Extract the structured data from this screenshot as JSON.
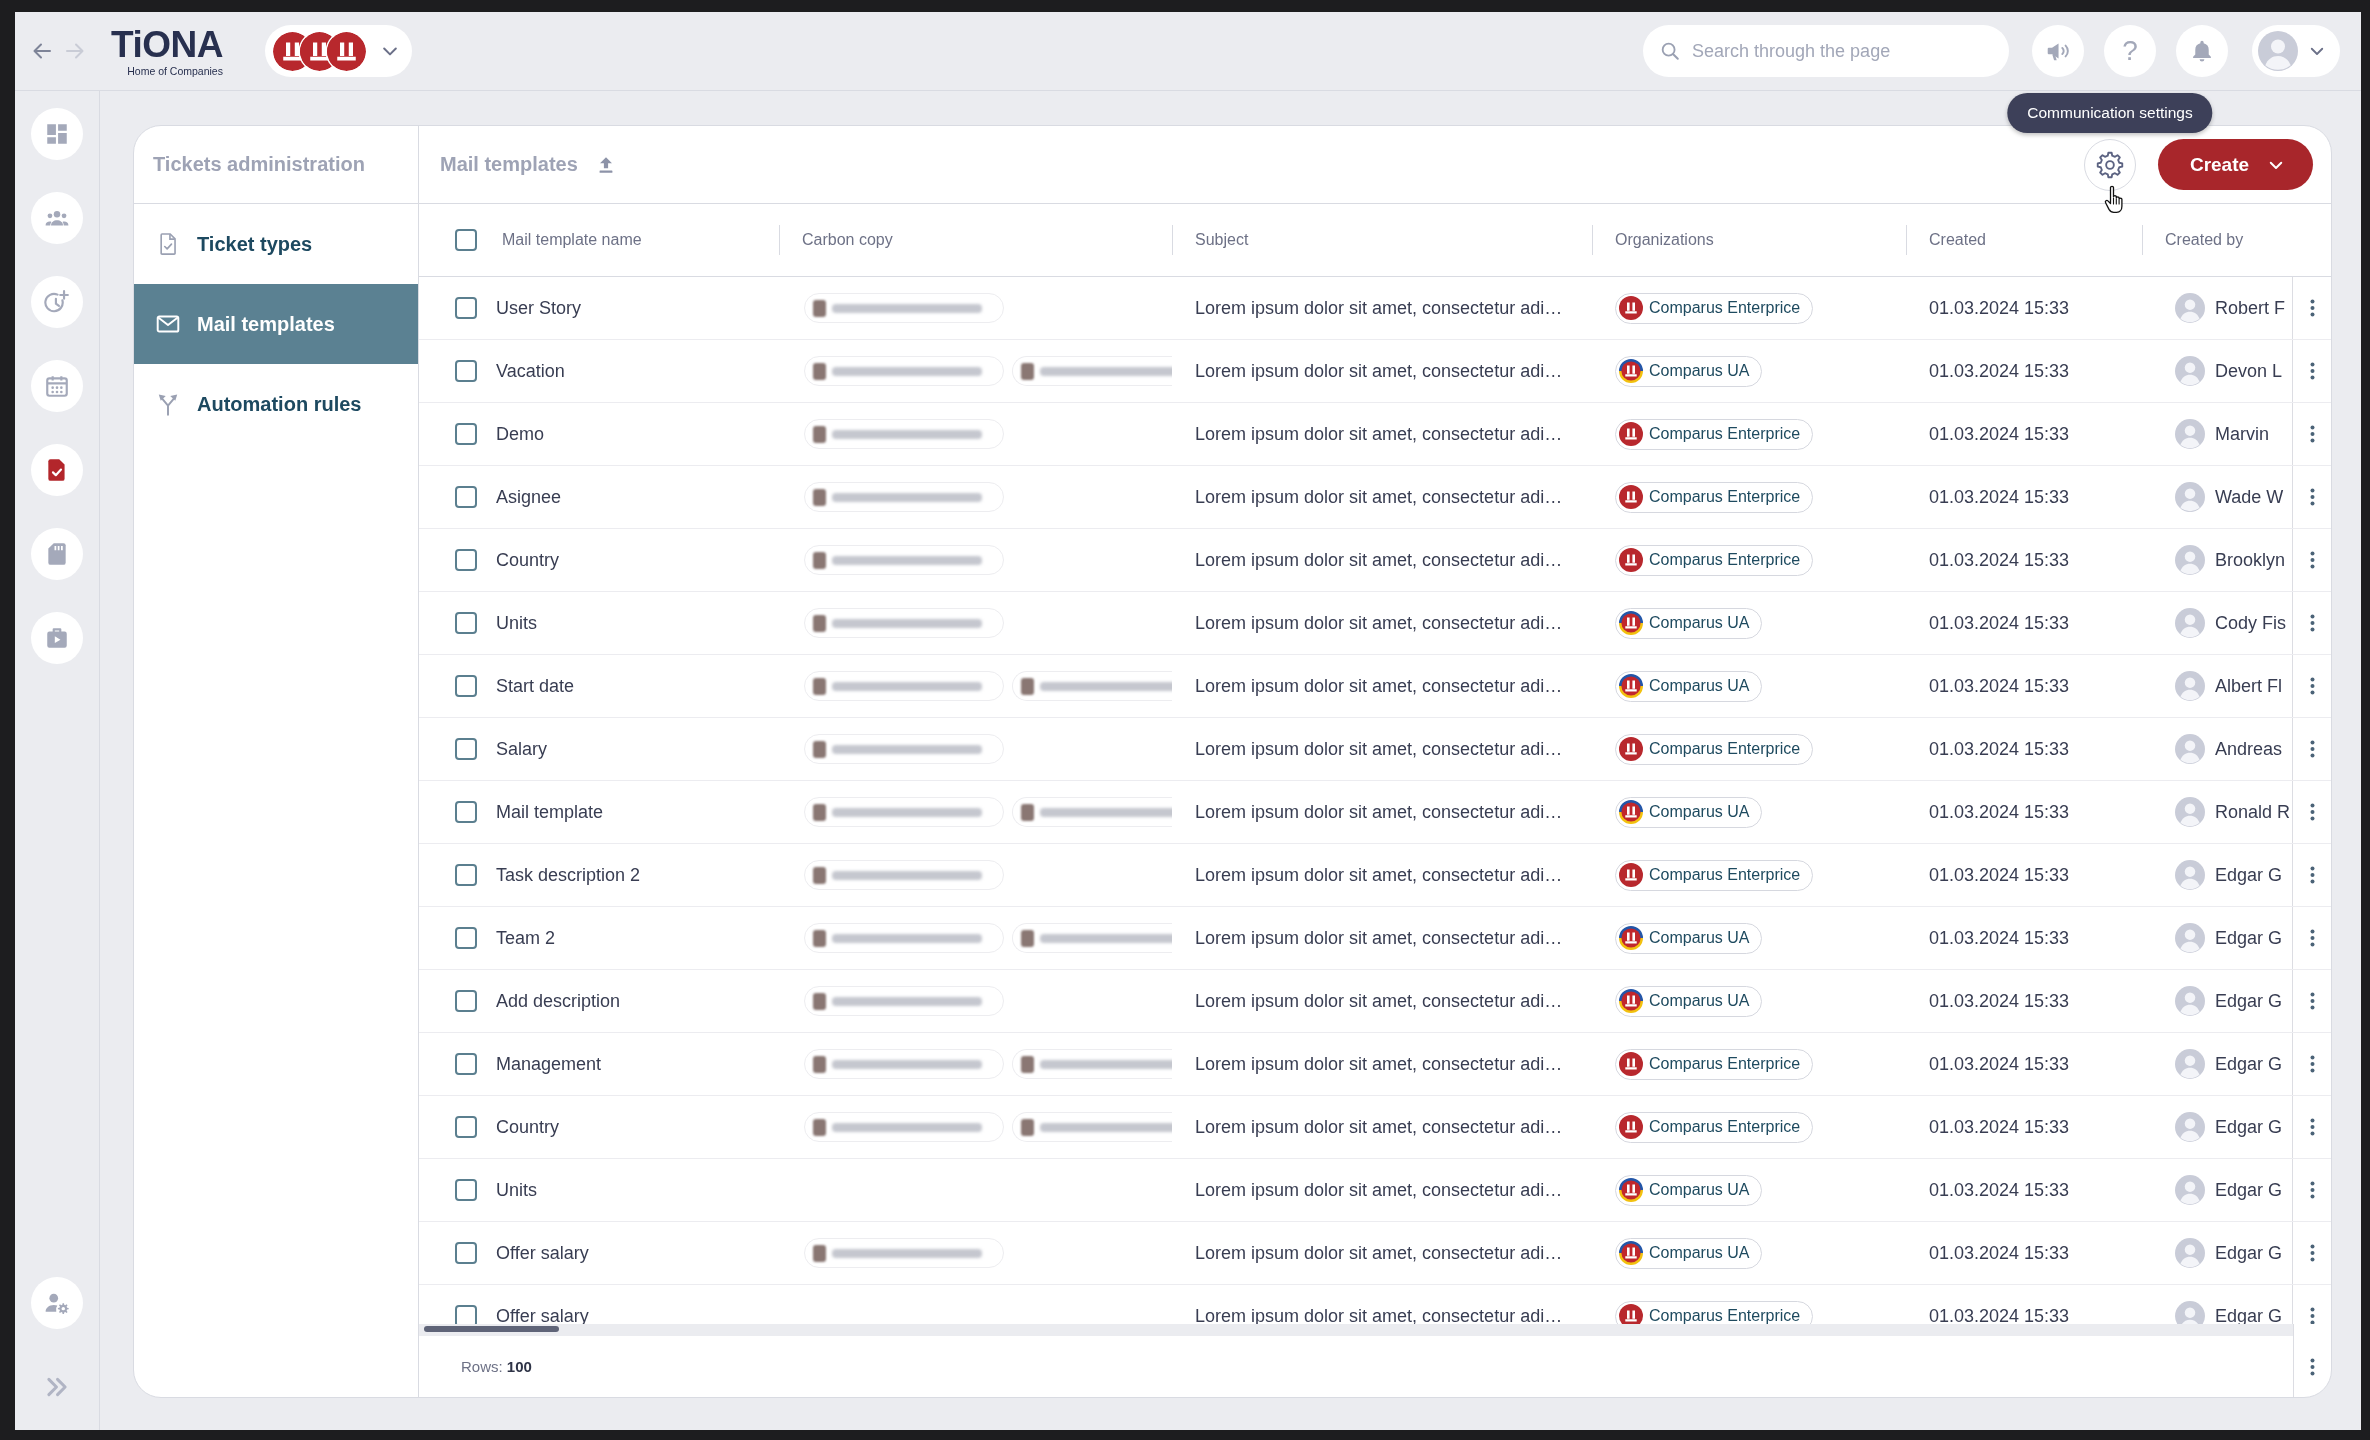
{
  "topbar": {
    "back": {
      "disabled": false
    },
    "forward": {
      "disabled": true
    },
    "logo": {
      "wordmark": "TiONA",
      "tagline": "Home of Companies"
    },
    "search": {
      "placeholder": "Search through the page"
    },
    "help": "?"
  },
  "rail": {
    "items": [
      {
        "selected": false
      },
      {
        "selected": false
      },
      {
        "selected": false
      },
      {
        "selected": false
      },
      {
        "selected": true
      },
      {
        "selected": false
      },
      {
        "selected": false
      }
    ]
  },
  "panel": {
    "title": "Tickets administration",
    "items": [
      {
        "label": "Ticket types",
        "selected": false
      },
      {
        "label": "Mail templates",
        "selected": true
      },
      {
        "label": "Automation rules",
        "selected": false
      }
    ]
  },
  "content": {
    "title": "Mail templates",
    "tooltip": "Communication settings",
    "create_button": "Create"
  },
  "table": {
    "select_all": {
      "checked": false
    },
    "columns": [
      "Mail template name",
      "Carbon copy",
      "Subject",
      "Organizations",
      "Created",
      "Created by"
    ],
    "rows": [
      {
        "name": "User Story",
        "selected": false,
        "carbon_copy": [
          {
            "kind": "blurred"
          }
        ],
        "subject": "Lorem ipsum dolor sit amet, consectetur adi…",
        "organization": {
          "name": "Comparus Enterprice",
          "kind": "plain"
        },
        "created": "01.03.2024 15:33",
        "created_by": "Robert F"
      },
      {
        "name": "Vacation",
        "selected": false,
        "carbon_copy": [
          {
            "kind": "blurred"
          },
          {
            "kind": "blurred"
          }
        ],
        "subject": "Lorem ipsum dolor sit amet, consectetur adi…",
        "organization": {
          "name": "Comparus UA",
          "kind": "ringed"
        },
        "created": "01.03.2024 15:33",
        "created_by": "Devon L"
      },
      {
        "name": "Demo",
        "selected": false,
        "carbon_copy": [
          {
            "kind": "blurred"
          }
        ],
        "subject": "Lorem ipsum dolor sit amet, consectetur adi…",
        "organization": {
          "name": "Comparus Enterprice",
          "kind": "plain"
        },
        "created": "01.03.2024 15:33",
        "created_by": "Marvin"
      },
      {
        "name": "Asignee",
        "selected": false,
        "carbon_copy": [
          {
            "kind": "blurred"
          }
        ],
        "subject": "Lorem ipsum dolor sit amet, consectetur adi…",
        "organization": {
          "name": "Comparus Enterprice",
          "kind": "plain"
        },
        "created": "01.03.2024 15:33",
        "created_by": "Wade W"
      },
      {
        "name": "Country",
        "selected": false,
        "carbon_copy": [
          {
            "kind": "blurred"
          }
        ],
        "subject": "Lorem ipsum dolor sit amet, consectetur adi…",
        "organization": {
          "name": "Comparus Enterprice",
          "kind": "plain"
        },
        "created": "01.03.2024 15:33",
        "created_by": "Brooklyn"
      },
      {
        "name": "Units",
        "selected": false,
        "carbon_copy": [
          {
            "kind": "blurred"
          }
        ],
        "subject": "Lorem ipsum dolor sit amet, consectetur adi…",
        "organization": {
          "name": "Comparus UA",
          "kind": "ringed"
        },
        "created": "01.03.2024 15:33",
        "created_by": "Cody Fis"
      },
      {
        "name": "Start date",
        "selected": false,
        "carbon_copy": [
          {
            "kind": "blurred"
          },
          {
            "kind": "blurred"
          }
        ],
        "subject": "Lorem ipsum dolor sit amet, consectetur adi…",
        "organization": {
          "name": "Comparus UA",
          "kind": "ringed"
        },
        "created": "01.03.2024 15:33",
        "created_by": "Albert Fl"
      },
      {
        "name": "Salary",
        "selected": false,
        "carbon_copy": [
          {
            "kind": "blurred"
          }
        ],
        "subject": "Lorem ipsum dolor sit amet, consectetur adi…",
        "organization": {
          "name": "Comparus Enterprice",
          "kind": "plain"
        },
        "created": "01.03.2024 15:33",
        "created_by": "Andreas"
      },
      {
        "name": "Mail template",
        "selected": false,
        "carbon_copy": [
          {
            "kind": "blurred"
          },
          {
            "kind": "blurred"
          }
        ],
        "subject": "Lorem ipsum dolor sit amet, consectetur adi…",
        "organization": {
          "name": "Comparus UA",
          "kind": "ringed"
        },
        "created": "01.03.2024 15:33",
        "created_by": "Ronald R"
      },
      {
        "name": "Task description 2",
        "selected": false,
        "carbon_copy": [
          {
            "kind": "blurred"
          }
        ],
        "subject": "Lorem ipsum dolor sit amet, consectetur adi…",
        "organization": {
          "name": "Comparus Enterprice",
          "kind": "plain"
        },
        "created": "01.03.2024 15:33",
        "created_by": "Edgar G"
      },
      {
        "name": "Team 2",
        "selected": false,
        "carbon_copy": [
          {
            "kind": "blurred"
          },
          {
            "kind": "blurred"
          }
        ],
        "subject": "Lorem ipsum dolor sit amet, consectetur adi…",
        "organization": {
          "name": "Comparus UA",
          "kind": "ringed"
        },
        "created": "01.03.2024 15:33",
        "created_by": "Edgar G"
      },
      {
        "name": "Add description",
        "selected": false,
        "carbon_copy": [
          {
            "kind": "blurred"
          }
        ],
        "subject": "Lorem ipsum dolor sit amet, consectetur adi…",
        "organization": {
          "name": "Comparus UA",
          "kind": "ringed"
        },
        "created": "01.03.2024 15:33",
        "created_by": "Edgar G"
      },
      {
        "name": "Management",
        "selected": false,
        "carbon_copy": [
          {
            "kind": "blurred"
          },
          {
            "kind": "blurred"
          }
        ],
        "subject": "Lorem ipsum dolor sit amet, consectetur adi…",
        "organization": {
          "name": "Comparus Enterprice",
          "kind": "plain"
        },
        "created": "01.03.2024 15:33",
        "created_by": "Edgar G"
      },
      {
        "name": "Country",
        "selected": false,
        "carbon_copy": [
          {
            "kind": "blurred"
          },
          {
            "kind": "blurred"
          }
        ],
        "subject": "Lorem ipsum dolor sit amet, consectetur adi…",
        "organization": {
          "name": "Comparus Enterprice",
          "kind": "plain"
        },
        "created": "01.03.2024 15:33",
        "created_by": "Edgar G"
      },
      {
        "name": "Units",
        "selected": false,
        "subject": "Lorem ipsum dolor sit amet, consectetur adi…",
        "organization": {
          "name": "Comparus UA",
          "kind": "ringed"
        },
        "created": "01.03.2024 15:33",
        "created_by": "Edgar G"
      },
      {
        "name": "Offer salary",
        "selected": false,
        "carbon_copy": [
          {
            "kind": "blurred"
          }
        ],
        "subject": "Lorem ipsum dolor sit amet, consectetur adi…",
        "organization": {
          "name": "Comparus UA",
          "kind": "ringed"
        },
        "created": "01.03.2024 15:33",
        "created_by": "Edgar G"
      },
      {
        "name": "Offer salary",
        "selected": false,
        "subject": "Lorem ipsum dolor sit amet, consectetur adi…",
        "organization": {
          "name": "Comparus Enterprice",
          "kind": "plain"
        },
        "created": "01.03.2024 15:33",
        "created_by": "Edgar G"
      }
    ]
  },
  "footer": {
    "rows": "Rows: **100**"
  }
}
